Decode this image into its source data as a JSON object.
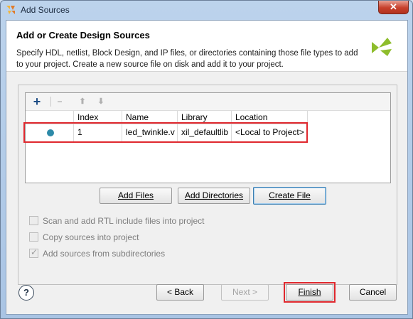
{
  "window": {
    "title": "Add Sources",
    "close_glyph": "✕"
  },
  "header": {
    "title": "Add or Create Design Sources",
    "description": "Specify HDL, netlist, Block Design, and IP files, or directories containing those file types to add to your project. Create a new source file on disk and add it to your project."
  },
  "toolbar": {
    "add_glyph": "+",
    "remove_glyph": "−",
    "up_glyph": "⬆",
    "down_glyph": "⬇"
  },
  "table": {
    "columns": [
      "Index",
      "Name",
      "Library",
      "Location"
    ],
    "rows": [
      {
        "index": "1",
        "name": "led_twinkle.v",
        "library": "xil_defaultlib",
        "location": "<Local to Project>",
        "status_color": "#2d8aa8"
      }
    ]
  },
  "buttons": {
    "add_files": "Add Files",
    "add_directories": "Add Directories",
    "create_file": "Create File",
    "back": "< Back",
    "next": "Next >",
    "finish": "Finish",
    "cancel": "Cancel",
    "help": "?"
  },
  "options": {
    "scan_rtl": {
      "label": "Scan and add RTL include files into project",
      "checked": false
    },
    "copy_sources": {
      "label": "Copy sources into project",
      "checked": false
    },
    "add_subdirs": {
      "label": "Add sources from subdirectories",
      "checked": true,
      "mark": "✓"
    }
  },
  "colors": {
    "highlight": "#e0282e",
    "accent": "#3c7fb1",
    "logo": "#8ebd2c"
  },
  "icons": {
    "logo": "vivado-logo-icon",
    "help": "help-icon",
    "close": "close-icon",
    "add": "add-icon",
    "remove": "remove-icon",
    "up": "move-up-icon",
    "down": "move-down-icon"
  }
}
